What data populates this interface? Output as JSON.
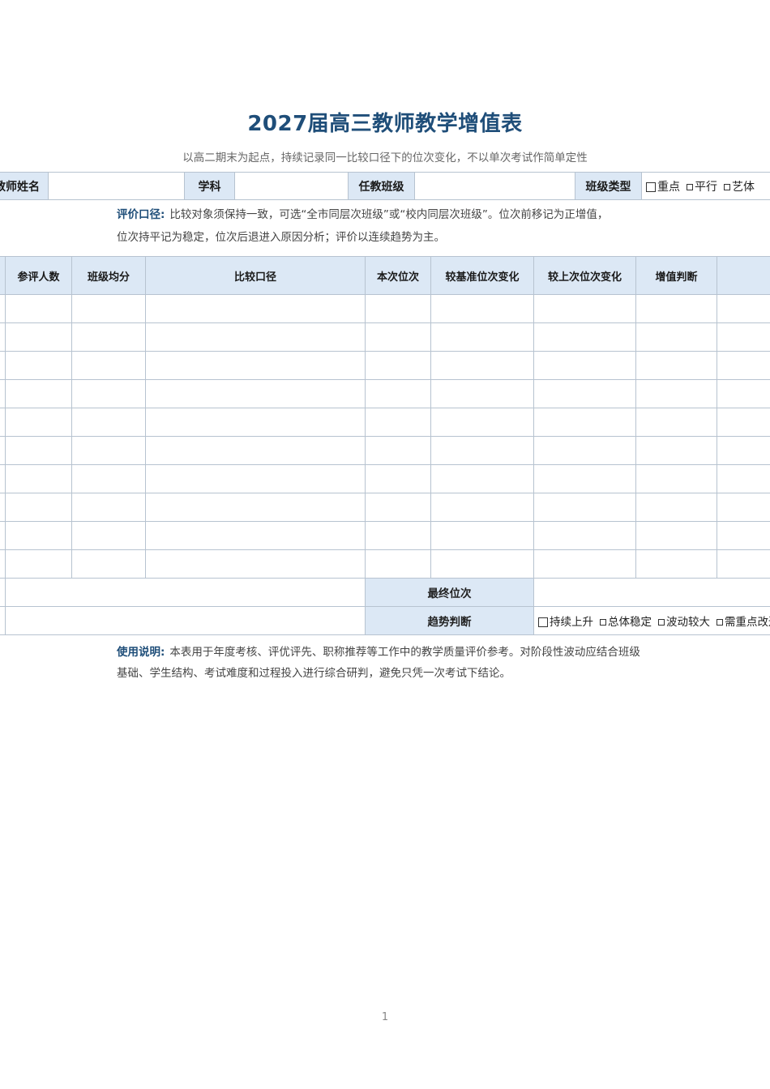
{
  "title": "2027届高三教师教学增值表",
  "subtitle": "以高二期末为起点，持续记录同一比较口径下的位次变化，不以单次考试作简单定性",
  "info": {
    "teacher_name_label": "教师姓名",
    "subject_label": "学科",
    "class_label": "任教班级",
    "class_type_label": "班级类型",
    "class_type_options": [
      "重点",
      "平行",
      "艺体"
    ]
  },
  "criteria": {
    "label": "评价口径:",
    "line1": "比较对象须保持一致，可选“全市同层次班级”或“校内同层次班级”。位次前移记为正增值，",
    "line2": "位次持平记为稳定，位次后退进入原因分析；评价以连续趋势为主。"
  },
  "table": {
    "headers": [
      "参评人数",
      "班级均分",
      "比较口径",
      "本次位次",
      "较基准位次变化",
      "较上次位次变化",
      "增值判断",
      ""
    ],
    "row_count": 10,
    "final_rank_label": "最终位次",
    "trend_label": "趋势判断",
    "trend_options": [
      "持续上升",
      "总体稳定",
      "波动较大",
      "需重点改进"
    ]
  },
  "usage": {
    "label": "使用说明:",
    "line1": "本表用于年度考核、评优评先、职称推荐等工作中的教学质量评价参考。对阶段性波动应结合班级",
    "line2": "基础、学生结构、考试难度和过程投入进行综合研判，避免只凭一次考试下结论。"
  },
  "page_number": "1"
}
